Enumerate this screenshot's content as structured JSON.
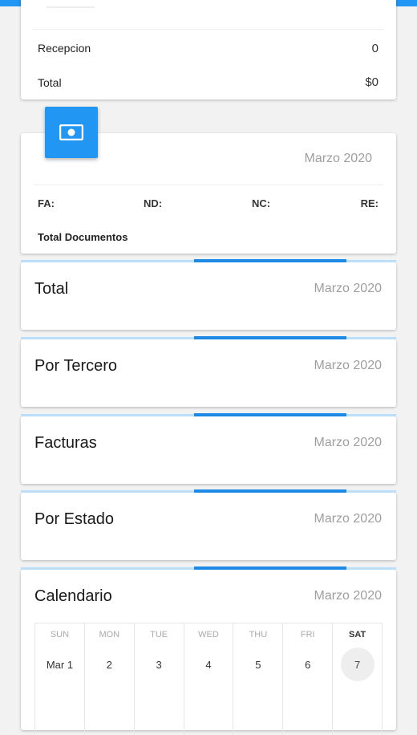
{
  "colors": {
    "accent": "#2196f3",
    "accent_dark": "#1e88e5",
    "accent_light": "#bbdefb"
  },
  "summary_card": {
    "rows": [
      {
        "label": "Recepcion",
        "value": "0"
      },
      {
        "label": "Total",
        "value": "$0"
      }
    ]
  },
  "documents_card": {
    "icon": "money-icon",
    "date": "Marzo 2020",
    "doc_types": [
      "FA:",
      "ND:",
      "NC:",
      "RE:"
    ],
    "total_label": "Total Documentos"
  },
  "sections": [
    {
      "title": "Total",
      "date": "Marzo 2020"
    },
    {
      "title": "Por Tercero",
      "date": "Marzo 2020"
    },
    {
      "title": "Facturas",
      "date": "Marzo 2020"
    },
    {
      "title": "Por Estado",
      "date": "Marzo 2020"
    }
  ],
  "calendar": {
    "title": "Calendario",
    "date": "Marzo 2020",
    "days_of_week": [
      "SUN",
      "MON",
      "TUE",
      "WED",
      "THU",
      "FRI",
      "SAT"
    ],
    "dates": [
      "Mar 1",
      "2",
      "3",
      "4",
      "5",
      "6",
      "7"
    ],
    "today": "7"
  }
}
